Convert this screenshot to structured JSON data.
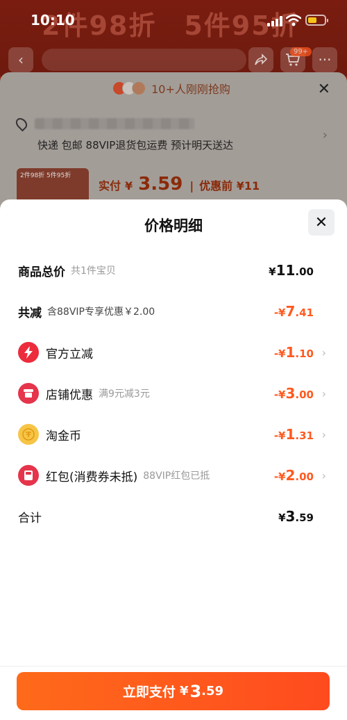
{
  "status_bar": {
    "time": "10:10"
  },
  "background": {
    "promo_banner": "2件98折　5件95折",
    "cart_badge": "99+",
    "header_text": "10+人刚刚抢购",
    "delivery_text": "快递 包邮 88VIP退货包运费 预计明天送达",
    "thumb_label": "2件98折  5件95折",
    "price_label": "实付",
    "price_currency": "¥",
    "price_amount": "3.59",
    "original_price": "优惠前 ¥11"
  },
  "sheet": {
    "title": "价格明细",
    "rows": [
      {
        "label": "商品总价",
        "sub": "共1件宝贝",
        "currency": "¥",
        "int": "11",
        "dec": ".00"
      },
      {
        "label": "共减",
        "sub": "含88VIP专享优惠￥2.00",
        "currency": "-¥",
        "int": "7",
        "dec": ".41"
      },
      {
        "label": "官方立减",
        "sub": "",
        "currency": "-¥",
        "int": "1",
        "dec": ".10",
        "icon": "lightning-icon"
      },
      {
        "label": "店铺优惠",
        "sub": "满9元减3元",
        "currency": "-¥",
        "int": "3",
        "dec": ".00",
        "icon": "shop-icon"
      },
      {
        "label": "淘金币",
        "sub": "",
        "currency": "-¥",
        "int": "1",
        "dec": ".31",
        "icon": "gold-coin-icon"
      },
      {
        "label": "红包(消费券未抵)",
        "sub": "88VIP红包已抵",
        "currency": "-¥",
        "int": "2",
        "dec": ".00",
        "icon": "red-packet-icon"
      },
      {
        "label": "合计",
        "sub": "",
        "currency": "¥",
        "int": "3",
        "dec": ".59"
      }
    ]
  },
  "pay_button": {
    "label": "立即支付",
    "currency": "¥",
    "int": "3",
    "dec": ".59"
  },
  "colors": {
    "accent": "#ff5a1f",
    "bolt": "#ec2b3c",
    "coin": "#f7c546"
  }
}
